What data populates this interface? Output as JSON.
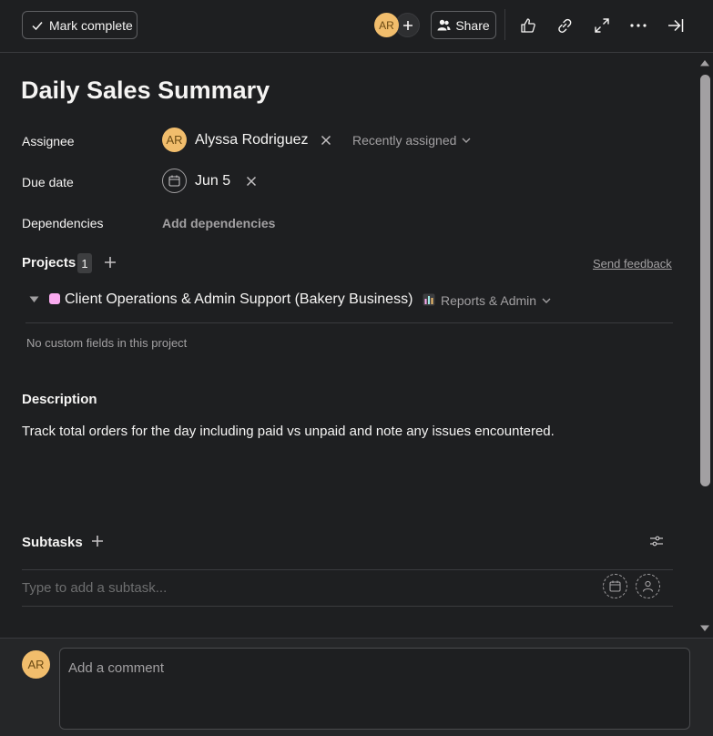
{
  "header": {
    "mark_complete_label": "Mark complete",
    "collaborator_initials": "AR",
    "share_label": "Share",
    "icons": [
      "check-icon",
      "plus-icon",
      "people-icon",
      "thumbs-up-icon",
      "link-icon",
      "expand-icon",
      "more-icon",
      "close-pane-icon"
    ]
  },
  "task": {
    "title": "Daily Sales Summary",
    "assignee": {
      "label": "Assignee",
      "initials": "AR",
      "name": "Alyssa Rodriguez",
      "recent_label": "Recently assigned"
    },
    "due_date": {
      "label": "Due date",
      "value": "Jun 5"
    },
    "dependencies": {
      "label": "Dependencies",
      "add_label": "Add dependencies"
    },
    "projects": {
      "label": "Projects",
      "count": "1",
      "send_feedback": "Send feedback",
      "items": [
        {
          "name": "Client Operations & Admin Support (Bakery Business)",
          "color": "#f9aaef",
          "section": "Reports & Admin",
          "no_fields": "No custom fields in this project"
        }
      ]
    },
    "description": {
      "label": "Description",
      "text": "Track total orders for the day including paid vs unpaid and note any issues encountered."
    },
    "subtasks": {
      "label": "Subtasks",
      "placeholder": "Type to add a subtask..."
    }
  },
  "comment": {
    "initials": "AR",
    "placeholder": "Add a comment"
  },
  "colors": {
    "background": "#1e1f21",
    "avatar": "#f1bd6c",
    "project_swatch": "#f9aaef",
    "muted_text": "#a2a0a2"
  }
}
